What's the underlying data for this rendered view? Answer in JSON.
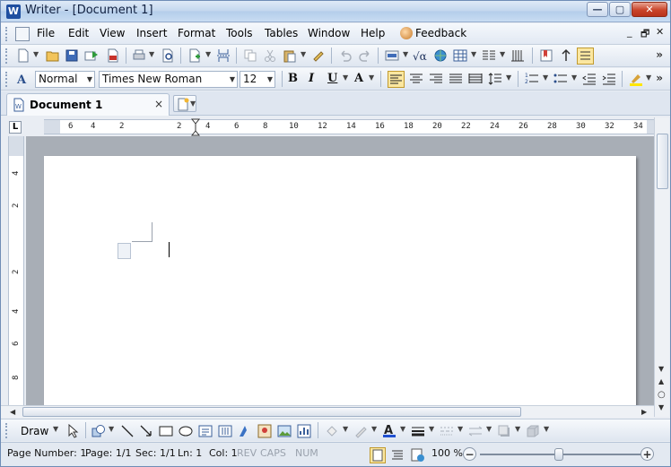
{
  "window": {
    "title": "Writer - [Document 1]",
    "app_icon_glyph": "W",
    "minimize": "—",
    "maximize": "▢",
    "close": "✕"
  },
  "menu": {
    "items": [
      {
        "label": "File"
      },
      {
        "label": "Edit"
      },
      {
        "label": "View"
      },
      {
        "label": "Insert"
      },
      {
        "label": "Format"
      },
      {
        "label": "Tools"
      },
      {
        "label": "Tables"
      },
      {
        "label": "Window"
      },
      {
        "label": "Help"
      },
      {
        "label": "Feedback"
      }
    ],
    "doc_controls": [
      "_",
      "🗗",
      "✕"
    ]
  },
  "formatting": {
    "style": "Normal",
    "font": "Times New Roman",
    "size": "12",
    "bold": "B",
    "italic": "I",
    "underline": "U",
    "grow": "A"
  },
  "tabs": {
    "active": "Document 1",
    "close": "×"
  },
  "ruler": {
    "labels": [
      "6",
      "4",
      "2",
      "2",
      "4",
      "6",
      "8",
      "10",
      "12",
      "14",
      "16",
      "18",
      "20",
      "22",
      "24",
      "26",
      "28",
      "30",
      "32",
      "34"
    ],
    "vertical_labels": [
      "4",
      "2",
      "2",
      "4",
      "6",
      "8"
    ],
    "tab_selector": "L"
  },
  "draw_toolbar": {
    "label": "Draw"
  },
  "status": {
    "page_number": "Page Number: 1",
    "page": "Page: 1/1",
    "section": "Sec: 1/1",
    "line": "Ln: 1",
    "column": "Col: 1",
    "rev": "REV",
    "caps": "CAPS",
    "num": "NUM",
    "zoom": "100 %",
    "zoom_out": "−",
    "zoom_in": "+"
  },
  "overflow_chevron": "»",
  "icons": [
    "new-icon",
    "open-icon",
    "save-icon",
    "send-icon",
    "pdf-icon",
    "print-icon",
    "print-preview-icon",
    "insert-page-icon",
    "page-break-icon",
    "copy-icon",
    "cut-icon",
    "paste-icon",
    "format-painter-icon",
    "undo-icon",
    "redo-icon",
    "insert-field-icon",
    "formula-icon",
    "hyperlink-icon",
    "table-icon",
    "columns-icon",
    "paragraph-marks-icon",
    "bookmark-icon",
    "navigator-icon"
  ]
}
